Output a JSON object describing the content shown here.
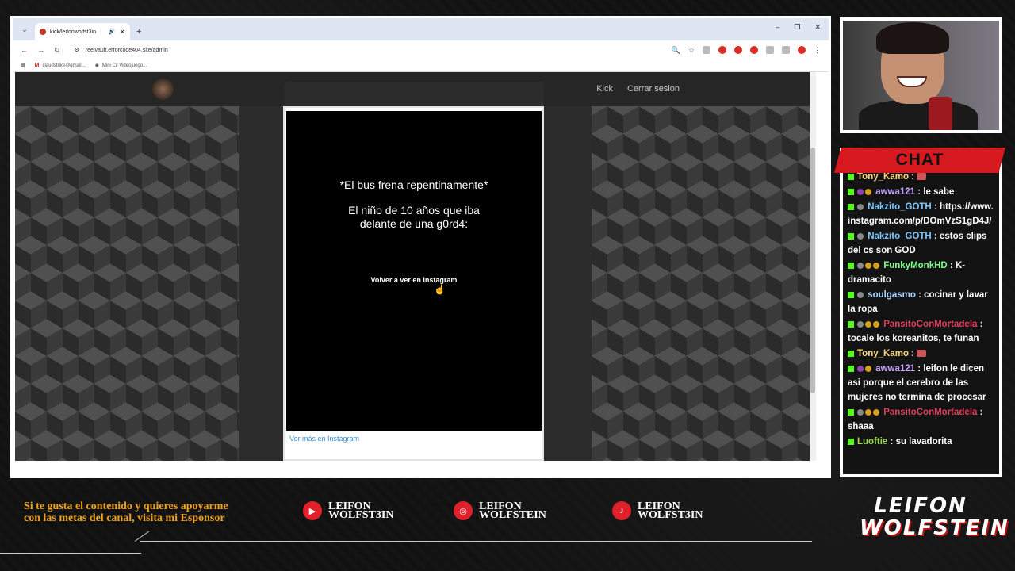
{
  "browser": {
    "tab_title": "kick/leifonwolfst3in",
    "url": "reelvault.errorcode404.site/admin",
    "bookmarks": [
      "claudstrike@gmail...",
      "Mini Cil Videojuego..."
    ]
  },
  "site": {
    "nav_links": [
      "Kick",
      "Cerrar sesion"
    ]
  },
  "embed": {
    "caption_line1": "*El bus frena repentinamente*",
    "caption_line2": "El niño de 10 años que iba delante de una g0rd4:",
    "replay_label": "Volver a ver en Instagram",
    "more_link": "Ver más en Instagram"
  },
  "chat": {
    "title": "CHAT",
    "messages": [
      {
        "user": "Tony_Kamo",
        "text": ""
      },
      {
        "user": "awwa121",
        "text": "le sabe"
      },
      {
        "user": "Nakzito_GOTH",
        "text": "https://www.instagram.com/p/DOmVzS1gD4J/"
      },
      {
        "user": "Nakzito_GOTH",
        "text": "estos clips del cs son GOD"
      },
      {
        "user": "FunkyMonkHD",
        "text": "K-dramacito"
      },
      {
        "user": "soulgasmo",
        "text": "cocinar y lavar la ropa"
      },
      {
        "user": "PansitoConMortadela",
        "text": "tocale los koreanitos, te funan"
      },
      {
        "user": "Tony_Kamo",
        "text": ""
      },
      {
        "user": "awwa121",
        "text": "leifon le dicen asi porque el cerebro de las mujeres no termina de procesar"
      },
      {
        "user": "PansitoConMortadela",
        "text": "shaaa"
      },
      {
        "user": "Luoftie",
        "text": "su lavadorita"
      }
    ]
  },
  "footer": {
    "sponsor_text": "Si te gusta el contenido y quieres apoyarme con las metas del canal, visita mi Esponsor",
    "socials": [
      {
        "platform": "youtube-icon",
        "label": "LEIFON\nWOLFST3IN"
      },
      {
        "platform": "instagram-icon",
        "label": "LEIFON\nWOLFSTEIN"
      },
      {
        "platform": "tiktok-icon",
        "label": "LEIFON\nWOLFST3IN"
      }
    ],
    "logo_line1": "LEIFON",
    "logo_line2": "WOLFSTEIN"
  },
  "colors": {
    "chat_header": "#d6191e",
    "sponsor_text": "#f0a019",
    "kick_green": "#53fc18"
  }
}
